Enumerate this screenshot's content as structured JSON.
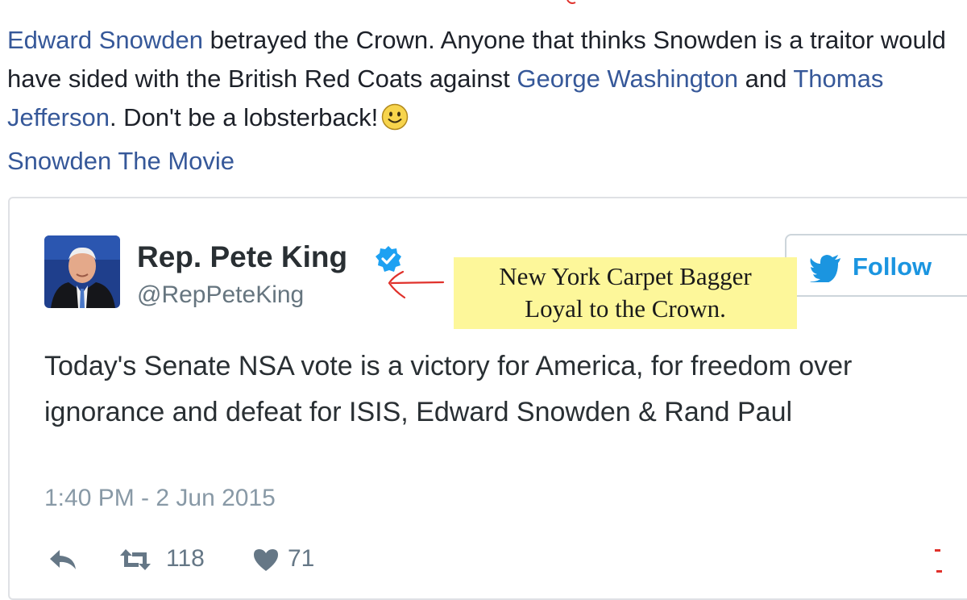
{
  "post": {
    "link_snowden": "Edward Snowden",
    "text_1": " betrayed the Crown. Anyone that thinks Snowden is a traitor would have sided with the British Red Coats against ",
    "link_washington": "George Washington",
    "text_2": " and ",
    "link_jefferson": "Thomas Jefferson",
    "text_3": ". Don't be a lobsterback!",
    "link_movie": "Snowden The Movie",
    "smiley_icon": "slightly-smiling-face-icon"
  },
  "tweet": {
    "display_name": "Rep. Pete King",
    "handle": "@RepPeteKing",
    "follow_label": "Follow",
    "body": "Today's Senate NSA vote is a victory for America, for freedom over ignorance and defeat for ISIS, Edward Snowden & Rand Paul",
    "timestamp": "1:40 PM - 2 Jun 2015",
    "retweet_count": "118",
    "like_count": "71"
  },
  "annotation": {
    "line_1": "New York Carpet Bagger",
    "line_2": "Loyal to the Crown."
  },
  "colors": {
    "link": "#365899",
    "twitter_blue": "#1b95e0",
    "annotation_bg": "#fdf79a",
    "annotation_arrow": "#e0312b",
    "muted": "#8899a6"
  }
}
